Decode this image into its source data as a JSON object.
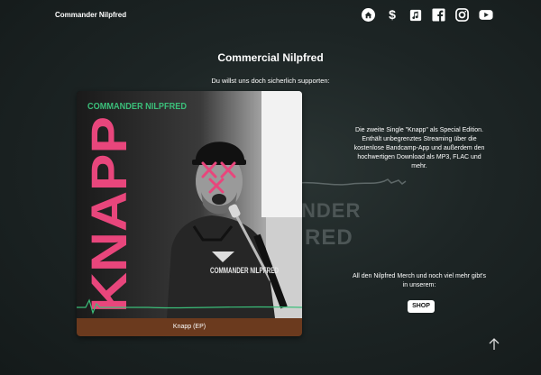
{
  "header": {
    "brand": "Commander Nilpfred",
    "nav_icons": [
      "home-icon",
      "dollar-icon",
      "music-note-icon",
      "facebook-icon",
      "instagram-icon",
      "youtube-icon"
    ]
  },
  "main": {
    "title": "Commercial Nilpfred",
    "subtitle": "Du willst uns doch sicherlich supporten:"
  },
  "album_card": {
    "cover_band_text": "COMMANDER NILPFRED",
    "cover_title": "KNAPP",
    "shirt_text": "COMMANDER NILPFRED",
    "caption": "Knapp (EP)"
  },
  "watermark": {
    "line1": "NDER",
    "line2": "RED"
  },
  "description": "Die zweite Single \"Knapp\" als Special Edition. Enthält unbegrenztes Streaming über die kostenlose Bandcamp-App und außerdem den hochwertigen Download als MP3, FLAC und mehr.",
  "merch": {
    "text": "All den Nilpfred Merch und noch viel mehr gibt's in unserem:",
    "button_label": "SHOP"
  },
  "colors": {
    "accent_pink": "#e8467c",
    "accent_green": "#3bbf7a",
    "caption_bg": "#6b3a1e"
  }
}
